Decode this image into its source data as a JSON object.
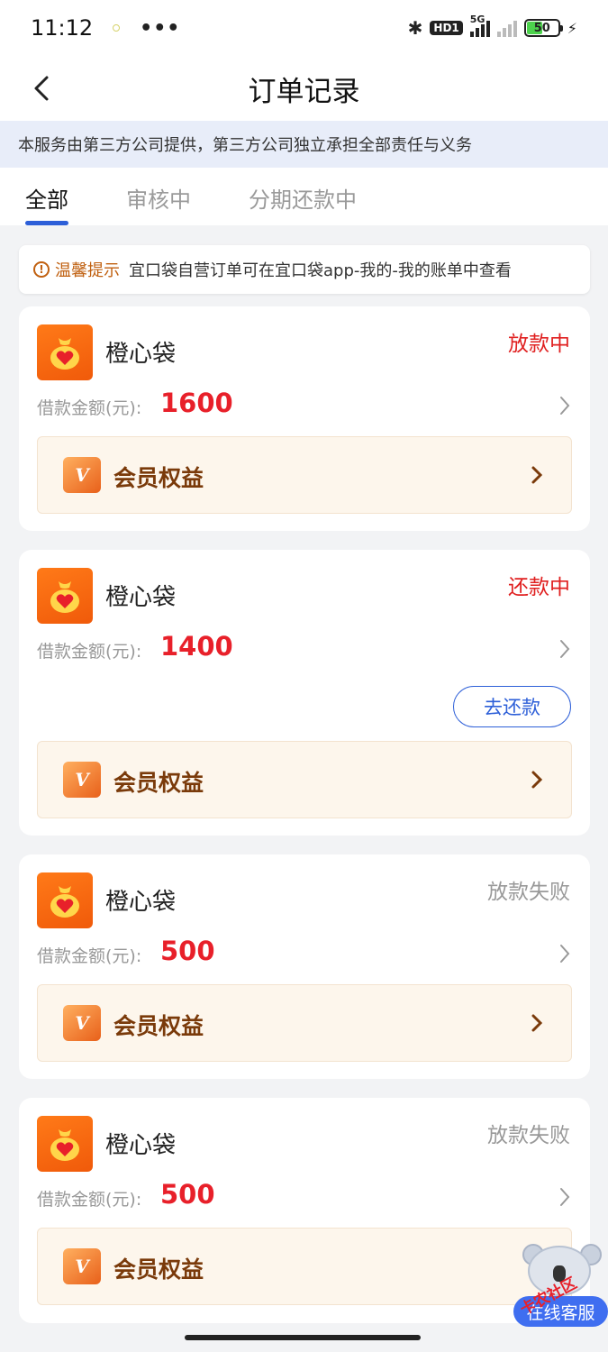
{
  "status_bar": {
    "time": "11:12",
    "more": "•••",
    "hd_badge": "HD1",
    "network": "5G",
    "battery": "50"
  },
  "nav": {
    "title": "订单记录"
  },
  "notice": {
    "text": "本服务由第三方公司提供，第三方公司独立承担全部责任与义务"
  },
  "tabs": [
    {
      "label": "全部",
      "active": true
    },
    {
      "label": "审核中",
      "active": false
    },
    {
      "label": "分期还款中",
      "active": false
    }
  ],
  "tip": {
    "label": "温馨提示",
    "text": "宜口袋自营订单可在宜口袋app-我的-我的账单中查看"
  },
  "orders": [
    {
      "brand": "橙心袋",
      "status": "放款中",
      "amount_label": "借款金额(元):",
      "amount": "1600",
      "vip_label": "会员权益"
    },
    {
      "brand": "橙心袋",
      "status": "还款中",
      "amount_label": "借款金额(元):",
      "amount": "1400",
      "action": "去还款",
      "vip_label": "会员权益"
    },
    {
      "brand": "橙心袋",
      "status": "放款失败",
      "amount_label": "借款金额(元):",
      "amount": "500",
      "vip_label": "会员权益"
    },
    {
      "brand": "橙心袋",
      "status": "放款失败",
      "amount_label": "借款金额(元):",
      "amount": "500",
      "vip_label": "会员权益"
    }
  ],
  "service": {
    "label": "在线客服",
    "stamp": "卡农社区"
  },
  "colors": {
    "accent": "#2d5fd8",
    "status_red": "#e02020",
    "amount_red": "#e8202a",
    "brand_orange": "#f05a0a"
  },
  "icons": {
    "logo": "heart-bag-icon",
    "vip": "vip-badge-icon",
    "back": "back-arrow-icon",
    "chevron": "chevron-right-icon"
  }
}
